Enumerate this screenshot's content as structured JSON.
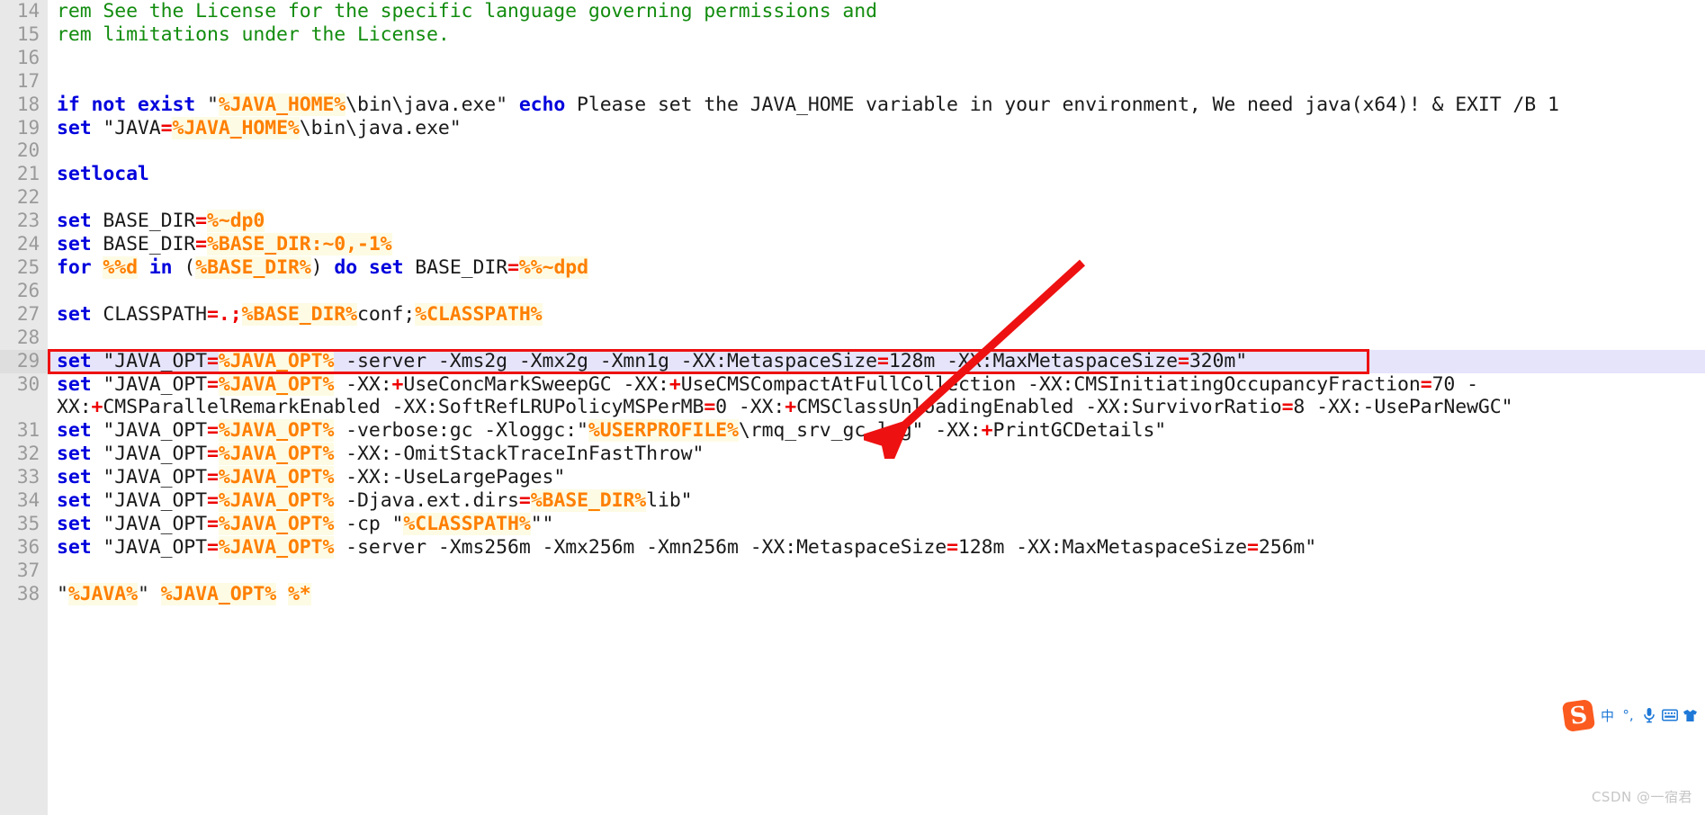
{
  "editor": {
    "language": "batch",
    "first_line": 14,
    "colors": {
      "keyword": "#0000dd",
      "variable": "#ff7f00",
      "variable_bg": "#fdfbe4",
      "operator": "#ee0000",
      "comment": "#128c0e",
      "plain": "#1a1a1a",
      "gutter_bg": "#e8e8e8",
      "gutter_text": "#9a9a9a",
      "current_line_bg": "#e6e4fa",
      "annotation": "#ee1111"
    },
    "lines": [
      {
        "number": "14",
        "text": "rem See the License for the specific language governing permissions and",
        "tokens": [
          {
            "t": "rem See the License for the specific language governing permissions and",
            "c": "cmt"
          }
        ]
      },
      {
        "number": "15",
        "text": "rem limitations under the License.",
        "tokens": [
          {
            "t": "rem limitations under the License.",
            "c": "cmt"
          }
        ]
      },
      {
        "number": "16",
        "text": "",
        "tokens": []
      },
      {
        "number": "17",
        "text": "",
        "tokens": []
      },
      {
        "number": "18",
        "text": "if not exist \"%JAVA_HOME%\\bin\\java.exe\" echo Please set the JAVA_HOME variable in your environment, We need java(x64)! & EXIT /B 1",
        "tokens": [
          {
            "t": "if not exist",
            "c": "kw"
          },
          {
            "t": " \"",
            "c": "plain"
          },
          {
            "t": "%JAVA_HOME%",
            "c": "var"
          },
          {
            "t": "\\bin\\java.exe\" ",
            "c": "plain"
          },
          {
            "t": "echo",
            "c": "kw"
          },
          {
            "t": " Please set the JAVA_HOME variable in your environment, We need java(x64)! & EXIT /B 1",
            "c": "plain"
          }
        ]
      },
      {
        "number": "19",
        "text": "set \"JAVA=%JAVA_HOME%\\bin\\java.exe\"",
        "tokens": [
          {
            "t": "set",
            "c": "kw"
          },
          {
            "t": " \"JAVA",
            "c": "plain"
          },
          {
            "t": "=",
            "c": "op"
          },
          {
            "t": "%JAVA_HOME%",
            "c": "var"
          },
          {
            "t": "\\bin\\java.exe\"",
            "c": "plain"
          }
        ]
      },
      {
        "number": "20",
        "text": "",
        "tokens": []
      },
      {
        "number": "21",
        "text": "setlocal",
        "tokens": [
          {
            "t": "setlocal",
            "c": "kw"
          }
        ]
      },
      {
        "number": "22",
        "text": "",
        "tokens": []
      },
      {
        "number": "23",
        "text": "set BASE_DIR=%~dp0",
        "tokens": [
          {
            "t": "set",
            "c": "kw"
          },
          {
            "t": " BASE_DIR",
            "c": "plain"
          },
          {
            "t": "=",
            "c": "op"
          },
          {
            "t": "%~dp0",
            "c": "var"
          }
        ]
      },
      {
        "number": "24",
        "text": "set BASE_DIR=%BASE_DIR:~0,-1%",
        "tokens": [
          {
            "t": "set",
            "c": "kw"
          },
          {
            "t": " BASE_DIR",
            "c": "plain"
          },
          {
            "t": "=",
            "c": "op"
          },
          {
            "t": "%BASE_DIR:~0,-1%",
            "c": "var"
          }
        ]
      },
      {
        "number": "25",
        "text": "for %%d in (%BASE_DIR%) do set BASE_DIR=%%~dpd",
        "tokens": [
          {
            "t": "for",
            "c": "kw"
          },
          {
            "t": " ",
            "c": "plain"
          },
          {
            "t": "%%d",
            "c": "var"
          },
          {
            "t": " ",
            "c": "plain"
          },
          {
            "t": "in",
            "c": "kw"
          },
          {
            "t": " (",
            "c": "plain"
          },
          {
            "t": "%BASE_DIR%",
            "c": "var"
          },
          {
            "t": ") ",
            "c": "plain"
          },
          {
            "t": "do set",
            "c": "kw"
          },
          {
            "t": " BASE_DIR",
            "c": "plain"
          },
          {
            "t": "=",
            "c": "op"
          },
          {
            "t": "%%~dpd",
            "c": "var"
          }
        ]
      },
      {
        "number": "26",
        "text": "",
        "tokens": []
      },
      {
        "number": "27",
        "text": "set CLASSPATH=.;%BASE_DIR%conf;%CLASSPATH%",
        "tokens": [
          {
            "t": "set",
            "c": "kw"
          },
          {
            "t": " CLASSPATH",
            "c": "plain"
          },
          {
            "t": "=.;",
            "c": "op"
          },
          {
            "t": "%BASE_DIR%",
            "c": "var"
          },
          {
            "t": "conf;",
            "c": "plain"
          },
          {
            "t": "%CLASSPATH%",
            "c": "var"
          }
        ]
      },
      {
        "number": "28",
        "text": "",
        "tokens": []
      },
      {
        "number": "29",
        "current": true,
        "text": "set \"JAVA_OPT=%JAVA_OPT% -server -Xms2g -Xmx2g -Xmn1g -XX:MetaspaceSize=128m -XX:MaxMetaspaceSize=320m\"",
        "tokens": [
          {
            "t": "set",
            "c": "kw"
          },
          {
            "t": " \"JAVA_OPT",
            "c": "plain"
          },
          {
            "t": "=",
            "c": "op"
          },
          {
            "t": "%JAVA_OPT%",
            "c": "var"
          },
          {
            "t": " -server -Xms2g -Xmx2g -Xmn1g -XX:MetaspaceSize",
            "c": "plain"
          },
          {
            "t": "=",
            "c": "op"
          },
          {
            "t": "128m -XX:MaxMetaspaceSize",
            "c": "plain"
          },
          {
            "t": "=",
            "c": "op"
          },
          {
            "t": "320m\"",
            "c": "plain"
          }
        ]
      },
      {
        "number": "30",
        "text": "set \"JAVA_OPT=%JAVA_OPT% -XX:+UseConcMarkSweepGC -XX:+UseCMSCompactAtFullCollection -XX:CMSInitiatingOccupancyFraction=70 -XX:+CMSParallelRemarkEnabled -XX:SoftRefLRUPolicyMSPerMB=0 -XX:+CMSClassUnloadingEnabled -XX:SurvivorRatio=8 -XX:-UseParNewGC\"",
        "tokens": [
          {
            "t": "set",
            "c": "kw"
          },
          {
            "t": " \"JAVA_OPT",
            "c": "plain"
          },
          {
            "t": "=",
            "c": "op"
          },
          {
            "t": "%JAVA_OPT%",
            "c": "var"
          },
          {
            "t": " -XX:",
            "c": "plain"
          },
          {
            "t": "+",
            "c": "op"
          },
          {
            "t": "UseConcMarkSweepGC -XX:",
            "c": "plain"
          },
          {
            "t": "+",
            "c": "op"
          },
          {
            "t": "UseCMSCompactAtFullCollection -XX:CMSInitiatingOccupancyFraction",
            "c": "plain"
          },
          {
            "t": "=",
            "c": "op"
          },
          {
            "t": "70 -XX:",
            "c": "plain"
          },
          {
            "t": "+",
            "c": "op"
          },
          {
            "t": "CMSParallelRemarkEnabled -XX:SoftRefLRUPolicyMSPerMB",
            "c": "plain"
          },
          {
            "t": "=",
            "c": "op"
          },
          {
            "t": "0 -XX:",
            "c": "plain"
          },
          {
            "t": "+",
            "c": "op"
          },
          {
            "t": "CMSClassUnloadingEnabled -XX:SurvivorRatio",
            "c": "plain"
          },
          {
            "t": "=",
            "c": "op"
          },
          {
            "t": "8 -XX:-UseParNewGC\"",
            "c": "plain"
          }
        ]
      },
      {
        "number": "31",
        "text": "set \"JAVA_OPT=%JAVA_OPT% -verbose:gc -Xloggc:\"%USERPROFILE%\\rmq_srv_gc.log\" -XX:+PrintGCDetails\"",
        "tokens": [
          {
            "t": "set",
            "c": "kw"
          },
          {
            "t": " \"JAVA_OPT",
            "c": "plain"
          },
          {
            "t": "=",
            "c": "op"
          },
          {
            "t": "%JAVA_OPT%",
            "c": "var"
          },
          {
            "t": " -verbose:gc -Xloggc:\"",
            "c": "plain"
          },
          {
            "t": "%USERPROFILE%",
            "c": "var"
          },
          {
            "t": "\\rmq_srv_gc.log\" -XX:",
            "c": "plain"
          },
          {
            "t": "+",
            "c": "op"
          },
          {
            "t": "PrintGCDetails\"",
            "c": "plain"
          }
        ]
      },
      {
        "number": "32",
        "text": "set \"JAVA_OPT=%JAVA_OPT% -XX:-OmitStackTraceInFastThrow\"",
        "tokens": [
          {
            "t": "set",
            "c": "kw"
          },
          {
            "t": " \"JAVA_OPT",
            "c": "plain"
          },
          {
            "t": "=",
            "c": "op"
          },
          {
            "t": "%JAVA_OPT%",
            "c": "var"
          },
          {
            "t": " -XX:-OmitStackTraceInFastThrow\"",
            "c": "plain"
          }
        ]
      },
      {
        "number": "33",
        "text": "set \"JAVA_OPT=%JAVA_OPT% -XX:-UseLargePages\"",
        "tokens": [
          {
            "t": "set",
            "c": "kw"
          },
          {
            "t": " \"JAVA_OPT",
            "c": "plain"
          },
          {
            "t": "=",
            "c": "op"
          },
          {
            "t": "%JAVA_OPT%",
            "c": "var"
          },
          {
            "t": " -XX:-UseLargePages\"",
            "c": "plain"
          }
        ]
      },
      {
        "number": "34",
        "text": "set \"JAVA_OPT=%JAVA_OPT% -Djava.ext.dirs=%BASE_DIR%lib\"",
        "tokens": [
          {
            "t": "set",
            "c": "kw"
          },
          {
            "t": " \"JAVA_OPT",
            "c": "plain"
          },
          {
            "t": "=",
            "c": "op"
          },
          {
            "t": "%JAVA_OPT%",
            "c": "var"
          },
          {
            "t": " -Djava.ext.dirs",
            "c": "plain"
          },
          {
            "t": "=",
            "c": "op"
          },
          {
            "t": "%BASE_DIR%",
            "c": "var"
          },
          {
            "t": "lib\"",
            "c": "plain"
          }
        ]
      },
      {
        "number": "35",
        "text": "set \"JAVA_OPT=%JAVA_OPT% -cp \"%CLASSPATH%\"\"",
        "tokens": [
          {
            "t": "set",
            "c": "kw"
          },
          {
            "t": " \"JAVA_OPT",
            "c": "plain"
          },
          {
            "t": "=",
            "c": "op"
          },
          {
            "t": "%JAVA_OPT%",
            "c": "var"
          },
          {
            "t": " -cp \"",
            "c": "plain"
          },
          {
            "t": "%CLASSPATH%",
            "c": "var"
          },
          {
            "t": "\"\"",
            "c": "plain"
          }
        ]
      },
      {
        "number": "36",
        "text": "set \"JAVA_OPT=%JAVA_OPT% -server -Xms256m -Xmx256m -Xmn256m -XX:MetaspaceSize=128m -XX:MaxMetaspaceSize=256m\"",
        "tokens": [
          {
            "t": "set",
            "c": "kw"
          },
          {
            "t": " \"JAVA_OPT",
            "c": "plain"
          },
          {
            "t": "=",
            "c": "op"
          },
          {
            "t": "%JAVA_OPT%",
            "c": "var"
          },
          {
            "t": " -server -Xms256m -Xmx256m -Xmn256m -XX:MetaspaceSize",
            "c": "plain"
          },
          {
            "t": "=",
            "c": "op"
          },
          {
            "t": "128m -XX:MaxMetaspaceSize",
            "c": "plain"
          },
          {
            "t": "=",
            "c": "op"
          },
          {
            "t": "256m\"",
            "c": "plain"
          }
        ]
      },
      {
        "number": "37",
        "text": "",
        "tokens": []
      },
      {
        "number": "38",
        "text": "\"%JAVA%\" %JAVA_OPT% %*",
        "tokens": [
          {
            "t": "\"",
            "c": "plain"
          },
          {
            "t": "%JAVA%",
            "c": "var"
          },
          {
            "t": "\" ",
            "c": "plain"
          },
          {
            "t": "%JAVA_OPT%",
            "c": "var"
          },
          {
            "t": " ",
            "c": "plain"
          },
          {
            "t": "%*",
            "c": "var"
          }
        ]
      }
    ]
  },
  "annotations": {
    "arrow": {
      "color": "#ee1111",
      "points_to_line": "29"
    },
    "highlight_box": {
      "color": "#ee1111",
      "line": "29"
    }
  },
  "ime": {
    "logo_text": "S",
    "items": [
      {
        "name": "chinese-mode",
        "glyph": "中"
      },
      {
        "name": "punctuation-mode",
        "glyph": "°,"
      },
      {
        "name": "voice-input",
        "glyph": "mic"
      },
      {
        "name": "soft-keyboard",
        "glyph": "keyboard"
      },
      {
        "name": "skin",
        "glyph": "shirt"
      }
    ]
  },
  "watermark": {
    "text": "CSDN @一宿君"
  }
}
